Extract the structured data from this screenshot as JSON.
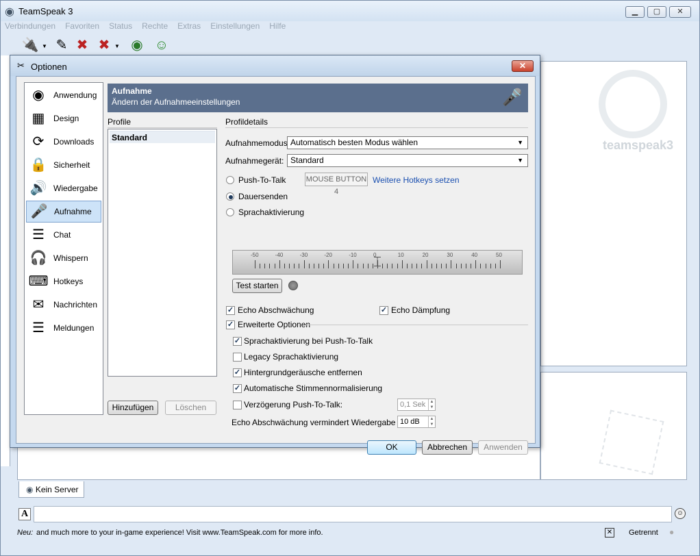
{
  "main": {
    "title": "TeamSpeak 3",
    "menu": [
      "Verbindungen",
      "Favoriten",
      "Status",
      "Rechte",
      "Extras",
      "Einstellungen",
      "Hilfe"
    ],
    "server_tab": "Kein Server",
    "logo_text": "teamspeak3",
    "status": {
      "news_label": "Neu:",
      "news_text": "and much more to your in-game experience! Visit www.TeamSpeak.com for more info.",
      "connection": "Getrennt"
    }
  },
  "dialog": {
    "title": "Optionen",
    "categories": [
      {
        "label": "Anwendung",
        "icon": "teamspeak-icon"
      },
      {
        "label": "Design",
        "icon": "design-icon"
      },
      {
        "label": "Downloads",
        "icon": "downloads-icon"
      },
      {
        "label": "Sicherheit",
        "icon": "lock-icon"
      },
      {
        "label": "Wiedergabe",
        "icon": "speaker-icon"
      },
      {
        "label": "Aufnahme",
        "icon": "microphone-icon"
      },
      {
        "label": "Chat",
        "icon": "chat-icon"
      },
      {
        "label": "Whispern",
        "icon": "headset-icon"
      },
      {
        "label": "Hotkeys",
        "icon": "hotkeys-icon"
      },
      {
        "label": "Nachrichten",
        "icon": "messages-icon"
      },
      {
        "label": "Meldungen",
        "icon": "notifications-icon"
      }
    ],
    "selected_category": "Aufnahme",
    "header": {
      "title": "Aufnahme",
      "subtitle": "Ändern der Aufnahmeeinstellungen"
    },
    "profiles": {
      "label": "Profile",
      "items": [
        "Standard"
      ],
      "add": "Hinzufügen",
      "delete": "Löschen"
    },
    "details": {
      "label": "Profildetails",
      "mode_label": "Aufnahmemodus:",
      "mode_value": "Automatisch besten Modus wählen",
      "device_label": "Aufnahmegerät:",
      "device_value": "Standard",
      "ptt": "Push-To-Talk",
      "ptt_hotkey": "MOUSE BUTTON 4",
      "more_hotkeys": "Weitere Hotkeys setzen",
      "continuous": "Dauersenden",
      "voice_activation": "Sprachaktivierung",
      "selected_mode": "Dauersenden",
      "slider_labels": [
        "-50",
        "-40",
        "-30",
        "-20",
        "-10",
        "0",
        "10",
        "20",
        "30",
        "40",
        "50"
      ],
      "slider_value": 0,
      "test_start": "Test starten",
      "echo_reduction": "Echo Abschwächung",
      "echo_cancel": "Echo Dämpfung",
      "advanced": "Erweiterte Optionen",
      "adv_voice_ptt": "Sprachaktivierung bei Push-To-Talk",
      "adv_legacy": "Legacy Sprachaktivierung",
      "adv_noise": "Hintergrundgeräusche entfernen",
      "adv_normalize": "Automatische Stimmennormalisierung",
      "adv_delay": "Verzögerung Push-To-Talk:",
      "delay_value": "0,1 Sek",
      "echo_reduce_label": "Echo Abschwächung vermindert Wiedergabe um:",
      "echo_reduce_value": "10 dB",
      "checks": {
        "echo_reduction": true,
        "echo_cancel": true,
        "advanced": true,
        "adv_voice_ptt": true,
        "adv_legacy": false,
        "adv_noise": true,
        "adv_normalize": true,
        "adv_delay": false
      }
    },
    "buttons": {
      "ok": "OK",
      "cancel": "Abbrechen",
      "apply": "Anwenden"
    }
  }
}
